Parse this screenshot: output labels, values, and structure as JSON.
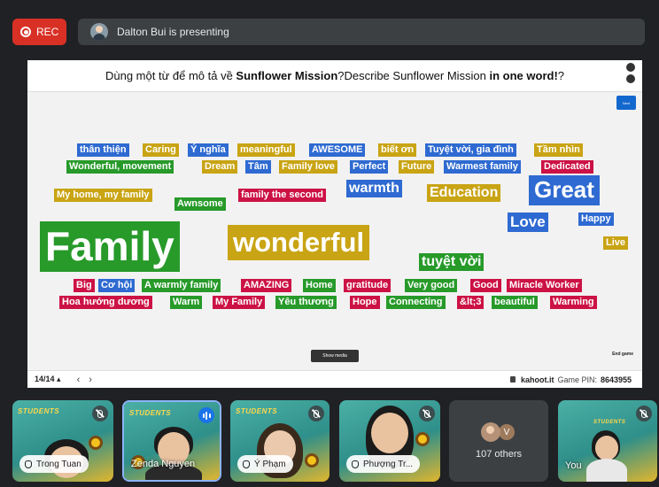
{
  "rec": {
    "label": "REC"
  },
  "presenter": {
    "text": "Dalton Bui is presenting"
  },
  "slide": {
    "title_vi": "Dùng một từ để mô tả về ",
    "title_vi_bold": "Sunflower Mission",
    "title_en": "?Describe Sunflower Mission ",
    "title_en_bold": "in one word!",
    "title_end": "?",
    "next_label": "Next",
    "show_media_label": "Show media",
    "end_game_label": "End game",
    "page": "14/14",
    "site": "kahoot.it",
    "game_pin_label": "Game PIN:",
    "game_pin": "8643955",
    "words": [
      {
        "text": "thân thiện",
        "color": "blue"
      },
      {
        "text": "Caring",
        "color": "yellow"
      },
      {
        "text": "Ý nghĩa",
        "color": "blue"
      },
      {
        "text": "meaningful",
        "color": "yellow"
      },
      {
        "text": "AWESOME",
        "color": "blue"
      },
      {
        "text": "biết ơn",
        "color": "yellow"
      },
      {
        "text": "Tuyệt vời, gia đình",
        "color": "blue"
      },
      {
        "text": "Tầm nhìn",
        "color": "yellow"
      },
      {
        "text": "Wonderful, movement",
        "color": "green"
      },
      {
        "text": "Dream",
        "color": "yellow"
      },
      {
        "text": "Tâm",
        "color": "blue"
      },
      {
        "text": "Family love",
        "color": "yellow"
      },
      {
        "text": "Perfect",
        "color": "blue"
      },
      {
        "text": "Future",
        "color": "yellow"
      },
      {
        "text": "Warmest family",
        "color": "blue"
      },
      {
        "text": "Dedicated",
        "color": "red"
      },
      {
        "text": "My home, my family",
        "color": "yellow"
      },
      {
        "text": "family the second",
        "color": "red"
      },
      {
        "text": "warmth",
        "color": "blue"
      },
      {
        "text": "Education",
        "color": "yellow"
      },
      {
        "text": "Great",
        "color": "blue"
      },
      {
        "text": "Awnsome",
        "color": "green"
      },
      {
        "text": "Love",
        "color": "blue"
      },
      {
        "text": "Happy",
        "color": "blue"
      },
      {
        "text": "Family",
        "color": "green"
      },
      {
        "text": "wonderful",
        "color": "yellow"
      },
      {
        "text": "Live",
        "color": "yellow"
      },
      {
        "text": "tuyệt vời",
        "color": "green"
      },
      {
        "text": "Big",
        "color": "red"
      },
      {
        "text": "Cơ hội",
        "color": "blue"
      },
      {
        "text": "A warmly family",
        "color": "green"
      },
      {
        "text": "AMAZING",
        "color": "red"
      },
      {
        "text": "Home",
        "color": "green"
      },
      {
        "text": "gratitude",
        "color": "red"
      },
      {
        "text": "Very good",
        "color": "green"
      },
      {
        "text": "Good",
        "color": "red"
      },
      {
        "text": "Miracle Worker",
        "color": "red"
      },
      {
        "text": "Hoa hướng dương",
        "color": "red"
      },
      {
        "text": "Warm",
        "color": "green"
      },
      {
        "text": "My Family",
        "color": "red"
      },
      {
        "text": "Yêu thương",
        "color": "green"
      },
      {
        "text": "Hope",
        "color": "red"
      },
      {
        "text": "Connecting",
        "color": "green"
      },
      {
        "text": "&lt;3",
        "color": "red"
      },
      {
        "text": "beautiful",
        "color": "green"
      },
      {
        "text": "Warming",
        "color": "red"
      }
    ]
  },
  "participants": [
    {
      "name": "Trong Tuan",
      "state": "muted"
    },
    {
      "name": "Zenda Nguyen",
      "state": "speaking"
    },
    {
      "name": "Ý Phạm",
      "state": "muted"
    },
    {
      "name": "Phượng Tr...",
      "state": "muted"
    },
    {
      "name": "You",
      "state": "muted"
    }
  ],
  "tile_banner": "STUDENTS",
  "others": {
    "initial": "V",
    "label": "107 others"
  },
  "colors": {
    "blue": "#2e6ad1",
    "yellow": "#c9a414",
    "green": "#279a2a",
    "red": "#cc1245",
    "rec": "#d93025"
  }
}
